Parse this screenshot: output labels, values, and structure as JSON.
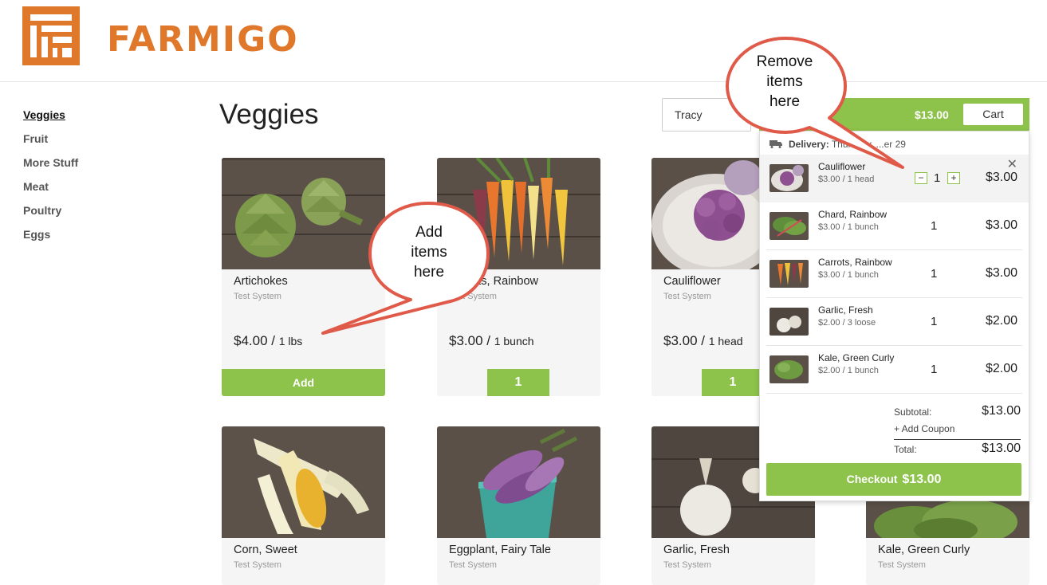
{
  "brand": {
    "name": "FARMIGO",
    "color": "#e0782c"
  },
  "accent_color": "#8dc34a",
  "sidebar": {
    "items": [
      {
        "label": "Veggies",
        "active": true
      },
      {
        "label": "Fruit"
      },
      {
        "label": "More Stuff"
      },
      {
        "label": "Meat"
      },
      {
        "label": "Poultry"
      },
      {
        "label": "Eggs"
      }
    ]
  },
  "page_title": "Veggies",
  "user_select": {
    "value": "Tracy"
  },
  "products": [
    {
      "name": "Artichokes",
      "vendor": "Test System",
      "price": "$4.00",
      "unit": "1 lbs",
      "button": "Add"
    },
    {
      "name": "Carrots, Rainbow",
      "vendor": "Test System",
      "price": "$3.00",
      "unit": "1 bunch",
      "qty": "1"
    },
    {
      "name": "Cauliflower",
      "vendor": "Test System",
      "price": "$3.00",
      "unit": "1 head",
      "qty": "1"
    },
    {
      "name": "Corn, Sweet",
      "vendor": "Test System"
    },
    {
      "name": "Eggplant, Fairy Tale",
      "vendor": "Test System"
    },
    {
      "name": "Garlic, Fresh",
      "vendor": "Test System"
    },
    {
      "name": "Kale, Green Curly",
      "vendor": "Test System"
    }
  ],
  "cart": {
    "total": "$13.00",
    "button_label": "Cart",
    "delivery_label": "Delivery:",
    "delivery_date": "Thursday, ...er 29",
    "items": [
      {
        "name": "Cauliflower",
        "price": "$3.00 / 1 head",
        "qty": "1",
        "total": "$3.00"
      },
      {
        "name": "Chard, Rainbow",
        "price": "$3.00 / 1 bunch",
        "qty": "1",
        "total": "$3.00"
      },
      {
        "name": "Carrots, Rainbow",
        "price": "$3.00 / 1 bunch",
        "qty": "1",
        "total": "$3.00"
      },
      {
        "name": "Garlic, Fresh",
        "price": "$2.00 / 3 loose",
        "qty": "1",
        "total": "$2.00"
      },
      {
        "name": "Kale, Green Curly",
        "price": "$2.00 / 1 bunch",
        "qty": "1",
        "total": "$2.00"
      }
    ],
    "subtotal_label": "Subtotal:",
    "subtotal": "$13.00",
    "coupon_label": "+ Add Coupon",
    "total_label": "Total:",
    "grand_total": "$13.00",
    "checkout_label": "Checkout",
    "checkout_amount": "$13.00"
  },
  "callouts": {
    "add": [
      "Add",
      "items",
      "here"
    ],
    "remove": [
      "Remove",
      "items",
      "here"
    ]
  }
}
